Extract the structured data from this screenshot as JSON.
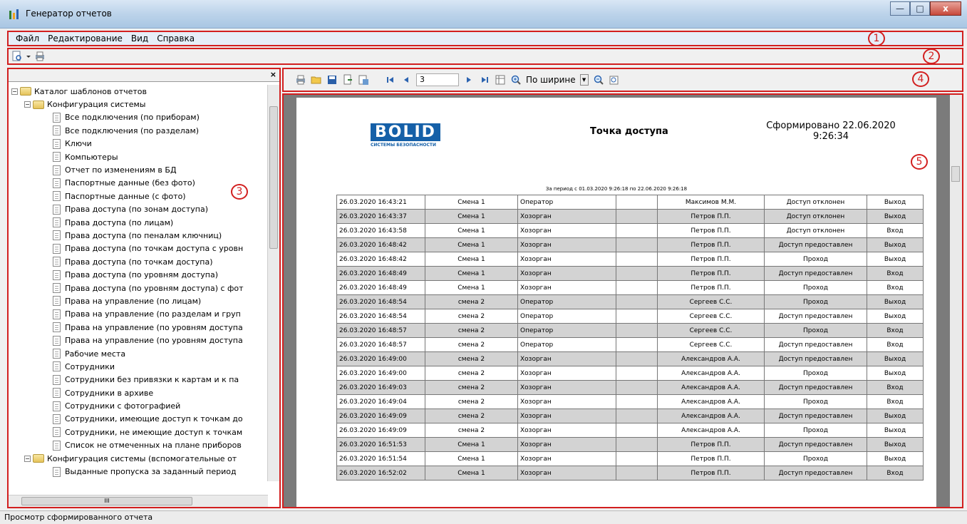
{
  "window": {
    "title": "Генератор отчетов",
    "minimize": "—",
    "maximize": "□",
    "close": "x"
  },
  "menu": [
    "Файл",
    "Редактирование",
    "Вид",
    "Справка"
  ],
  "callouts": [
    "1",
    "2",
    "3",
    "4",
    "5"
  ],
  "left_panel": {
    "close": "×",
    "tree": [
      {
        "level": 0,
        "type": "folder",
        "expander": "−",
        "label": "Каталог шаблонов отчетов"
      },
      {
        "level": 1,
        "type": "folder",
        "expander": "−",
        "label": "Конфигурация системы"
      },
      {
        "level": 2,
        "type": "doc",
        "label": "Все подключения (по приборам)"
      },
      {
        "level": 2,
        "type": "doc",
        "label": "Все подключения (по разделам)"
      },
      {
        "level": 2,
        "type": "doc",
        "label": "Ключи"
      },
      {
        "level": 2,
        "type": "doc",
        "label": "Компьютеры"
      },
      {
        "level": 2,
        "type": "doc",
        "label": "Отчет по изменениям в БД"
      },
      {
        "level": 2,
        "type": "doc",
        "label": "Паспортные данные (без фото)"
      },
      {
        "level": 2,
        "type": "doc",
        "label": "Паспортные данные (с фото)"
      },
      {
        "level": 2,
        "type": "doc",
        "label": "Права доступа (по зонам доступа)"
      },
      {
        "level": 2,
        "type": "doc",
        "label": "Права доступа (по лицам)"
      },
      {
        "level": 2,
        "type": "doc",
        "label": "Права доступа (по пеналам ключниц)"
      },
      {
        "level": 2,
        "type": "doc",
        "label": "Права доступа (по точкам доступа с уровн"
      },
      {
        "level": 2,
        "type": "doc",
        "label": "Права доступа (по точкам доступа)"
      },
      {
        "level": 2,
        "type": "doc",
        "label": "Права доступа (по уровням доступа)"
      },
      {
        "level": 2,
        "type": "doc",
        "label": "Права доступа (по уровням доступа) с фот"
      },
      {
        "level": 2,
        "type": "doc",
        "label": "Права на управление (по лицам)"
      },
      {
        "level": 2,
        "type": "doc",
        "label": "Права на управление (по разделам и груп"
      },
      {
        "level": 2,
        "type": "doc",
        "label": "Права на управление (по уровням доступа"
      },
      {
        "level": 2,
        "type": "doc",
        "label": "Права на управление (по уровням доступа"
      },
      {
        "level": 2,
        "type": "doc",
        "label": "Рабочие места"
      },
      {
        "level": 2,
        "type": "doc",
        "label": "Сотрудники"
      },
      {
        "level": 2,
        "type": "doc",
        "label": "Сотрудники без привязки к картам и к па"
      },
      {
        "level": 2,
        "type": "doc",
        "label": "Сотрудники в архиве"
      },
      {
        "level": 2,
        "type": "doc",
        "label": "Сотрудники с фотографией"
      },
      {
        "level": 2,
        "type": "doc",
        "label": "Сотрудники, имеющие доступ к точкам до"
      },
      {
        "level": 2,
        "type": "doc",
        "label": "Сотрудники, не имеющие доступ к точкам"
      },
      {
        "level": 2,
        "type": "doc",
        "label": "Список не отмеченных на плане приборов"
      },
      {
        "level": 1,
        "type": "folder",
        "expander": "−",
        "label": "Конфигурация системы (вспомогательные от"
      },
      {
        "level": 2,
        "type": "doc",
        "label": "Выданные пропуска за заданный период"
      }
    ],
    "hscroll_grip": "III"
  },
  "report_toolbar": {
    "page_number": "3",
    "zoom_label": "По ширине",
    "dropdown_arrow": "▼"
  },
  "report": {
    "logo_main": "BOLID",
    "logo_sub": "СИСТЕМЫ БЕЗОПАСНОСТИ",
    "title": "Точка доступа",
    "formed_line1": "Сформировано 22.06.2020",
    "formed_line2": "9:26:34",
    "period": "За период с 01.03.2020 9:26:18 по 22.06.2020 9:26:18",
    "rows": [
      [
        "26.03.2020 16:43:21",
        "Смена 1",
        "Оператор",
        "",
        "Максимов М.М.",
        "Доступ отклонен",
        "Выход"
      ],
      [
        "26.03.2020 16:43:37",
        "Смена 1",
        "Хозорган",
        "",
        "Петров П.П.",
        "Доступ отклонен",
        "Выход"
      ],
      [
        "26.03.2020 16:43:58",
        "Смена 1",
        "Хозорган",
        "",
        "Петров П.П.",
        "Доступ отклонен",
        "Вход"
      ],
      [
        "26.03.2020 16:48:42",
        "Смена 1",
        "Хозорган",
        "",
        "Петров П.П.",
        "Доступ предоставлен",
        "Выход"
      ],
      [
        "26.03.2020 16:48:42",
        "Смена 1",
        "Хозорган",
        "",
        "Петров П.П.",
        "Проход",
        "Выход"
      ],
      [
        "26.03.2020 16:48:49",
        "Смена 1",
        "Хозорган",
        "",
        "Петров П.П.",
        "Доступ предоставлен",
        "Вход"
      ],
      [
        "26.03.2020 16:48:49",
        "Смена 1",
        "Хозорган",
        "",
        "Петров П.П.",
        "Проход",
        "Вход"
      ],
      [
        "26.03.2020 16:48:54",
        "смена 2",
        "Оператор",
        "",
        "Сергеев С.С.",
        "Проход",
        "Выход"
      ],
      [
        "26.03.2020 16:48:54",
        "смена 2",
        "Оператор",
        "",
        "Сергеев С.С.",
        "Доступ предоставлен",
        "Выход"
      ],
      [
        "26.03.2020 16:48:57",
        "смена 2",
        "Оператор",
        "",
        "Сергеев С.С.",
        "Проход",
        "Вход"
      ],
      [
        "26.03.2020 16:48:57",
        "смена 2",
        "Оператор",
        "",
        "Сергеев С.С.",
        "Доступ предоставлен",
        "Вход"
      ],
      [
        "26.03.2020 16:49:00",
        "смена 2",
        "Хозорган",
        "",
        "Александров А.А.",
        "Доступ предоставлен",
        "Выход"
      ],
      [
        "26.03.2020 16:49:00",
        "смена 2",
        "Хозорган",
        "",
        "Александров А.А.",
        "Проход",
        "Выход"
      ],
      [
        "26.03.2020 16:49:03",
        "смена 2",
        "Хозорган",
        "",
        "Александров А.А.",
        "Доступ предоставлен",
        "Вход"
      ],
      [
        "26.03.2020 16:49:04",
        "смена 2",
        "Хозорган",
        "",
        "Александров А.А.",
        "Проход",
        "Вход"
      ],
      [
        "26.03.2020 16:49:09",
        "смена 2",
        "Хозорган",
        "",
        "Александров А.А.",
        "Доступ предоставлен",
        "Выход"
      ],
      [
        "26.03.2020 16:49:09",
        "смена 2",
        "Хозорган",
        "",
        "Александров А.А.",
        "Проход",
        "Выход"
      ],
      [
        "26.03.2020 16:51:53",
        "Смена 1",
        "Хозорган",
        "",
        "Петров П.П.",
        "Доступ предоставлен",
        "Выход"
      ],
      [
        "26.03.2020 16:51:54",
        "Смена 1",
        "Хозорган",
        "",
        "Петров П.П.",
        "Проход",
        "Выход"
      ],
      [
        "26.03.2020 16:52:02",
        "Смена 1",
        "Хозорган",
        "",
        "Петров П.П.",
        "Доступ предоставлен",
        "Вход"
      ]
    ]
  },
  "status": "Просмотр сформированного отчета",
  "colors": {
    "annotation_red": "#d21f1f",
    "logo_blue": "#1560a8",
    "row_shade": "#d3d3d3"
  },
  "icons": [
    "app-icon",
    "preview-icon",
    "print-icon",
    "open-folder-icon",
    "save-icon",
    "export-icon",
    "first-page-icon",
    "prev-page-icon",
    "next-page-icon",
    "last-page-icon",
    "page-layout-icon",
    "zoom-in-icon",
    "zoom-out-icon",
    "find-icon"
  ]
}
